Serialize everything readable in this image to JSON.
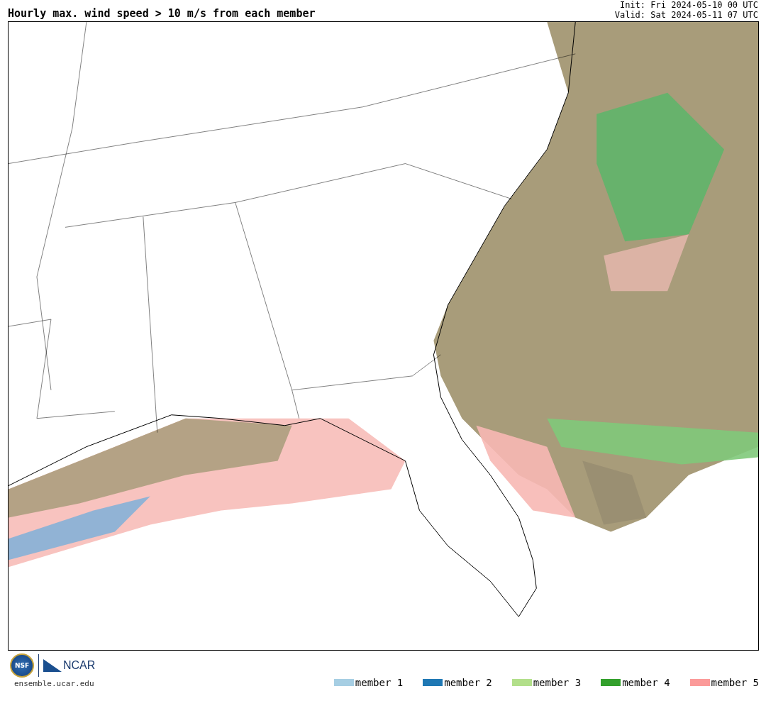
{
  "title": "Hourly max. wind speed > 10 m/s from each member",
  "init": "Init: Fri 2024-05-10 00 UTC",
  "valid": "Valid: Sat 2024-05-11 07 UTC",
  "logos": {
    "nsf": "NSF",
    "ncar": "NCAR"
  },
  "site": "ensemble.ucar.edu",
  "legend": [
    {
      "label": "member 1",
      "color": "#a6cee3"
    },
    {
      "label": "member 2",
      "color": "#1f78b4"
    },
    {
      "label": "member 3",
      "color": "#b2df8a"
    },
    {
      "label": "member 4",
      "color": "#33a02c"
    },
    {
      "label": "member 5",
      "color": "#fb9a99"
    }
  ]
}
